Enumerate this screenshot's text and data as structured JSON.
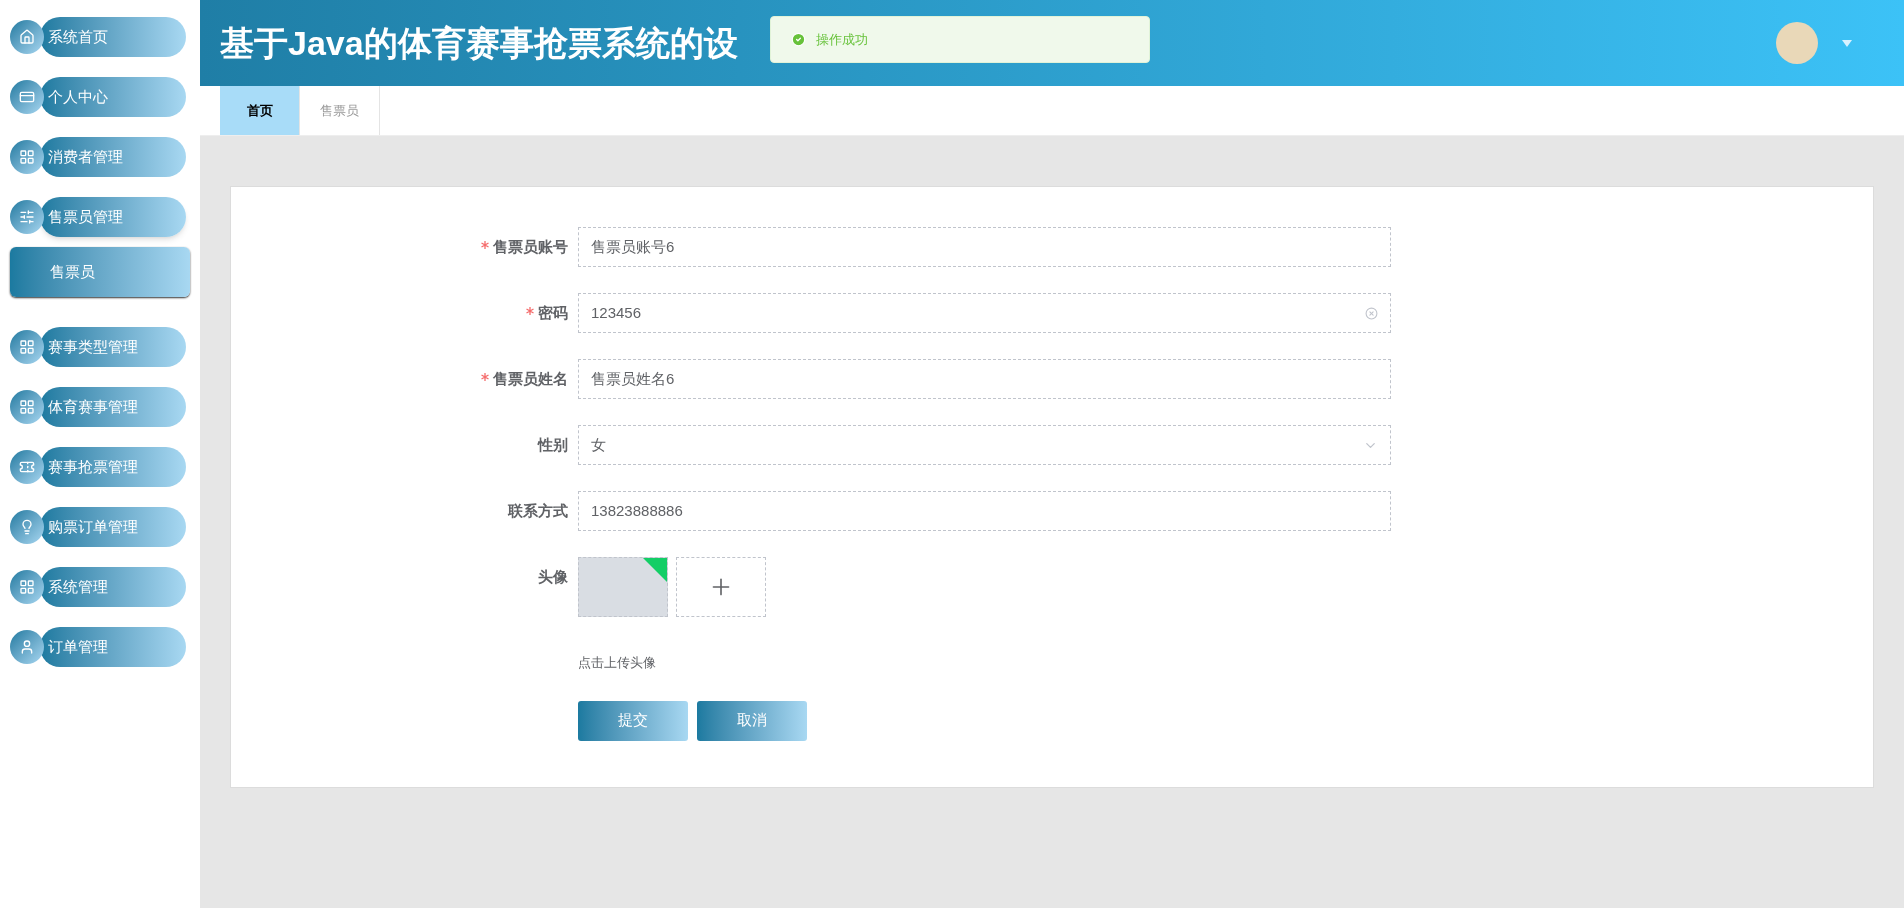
{
  "header": {
    "title": "基于Java的体育赛事抢票系统的设",
    "toast": {
      "message": "操作成功"
    }
  },
  "sidebar": {
    "items": [
      {
        "label": "系统首页",
        "expanded": false
      },
      {
        "label": "个人中心",
        "expanded": false
      },
      {
        "label": "消费者管理",
        "expanded": false
      },
      {
        "label": "售票员管理",
        "expanded": true,
        "children": [
          {
            "label": "售票员"
          }
        ]
      },
      {
        "label": "赛事类型管理",
        "expanded": false
      },
      {
        "label": "体育赛事管理",
        "expanded": false
      },
      {
        "label": "赛事抢票管理",
        "expanded": false
      },
      {
        "label": "购票订单管理",
        "expanded": false
      },
      {
        "label": "系统管理",
        "expanded": false
      },
      {
        "label": "订单管理",
        "expanded": false
      }
    ]
  },
  "tabs": [
    {
      "label": "首页",
      "selected": true
    },
    {
      "label": "售票员",
      "selected": false
    }
  ],
  "form": {
    "fields": [
      {
        "kind": "input",
        "label": "售票员账号",
        "required": true,
        "value": "售票员账号6",
        "clearable": false
      },
      {
        "kind": "input",
        "label": "密码",
        "required": true,
        "value": "123456",
        "clearable": true
      },
      {
        "kind": "input",
        "label": "售票员姓名",
        "required": true,
        "value": "售票员姓名6",
        "clearable": false
      },
      {
        "kind": "select",
        "label": "性别",
        "required": false,
        "value": "女"
      },
      {
        "kind": "input",
        "label": "联系方式",
        "required": false,
        "value": "13823888886",
        "clearable": false
      },
      {
        "kind": "upload",
        "label": "头像",
        "required": false,
        "hint": "点击上传头像",
        "uploaded": true
      }
    ],
    "buttons": [
      "提交",
      "取消"
    ]
  }
}
